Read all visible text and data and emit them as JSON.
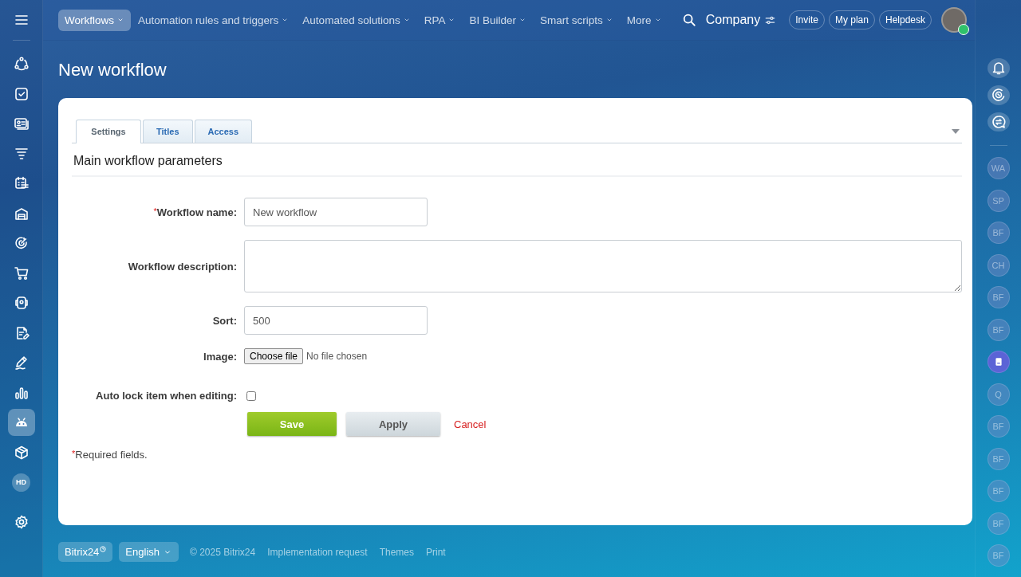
{
  "left_sidebar": {
    "items": [
      {
        "kind": "icon",
        "selected": false
      },
      {
        "kind": "icon",
        "selected": false
      },
      {
        "kind": "icon",
        "selected": false
      },
      {
        "kind": "icon",
        "selected": false
      },
      {
        "kind": "icon",
        "selected": false
      },
      {
        "kind": "icon",
        "selected": false
      },
      {
        "kind": "icon",
        "selected": false
      },
      {
        "kind": "icon",
        "selected": false
      },
      {
        "kind": "icon",
        "selected": false
      },
      {
        "kind": "icon",
        "selected": false
      },
      {
        "kind": "icon",
        "selected": false
      },
      {
        "kind": "icon",
        "selected": false
      },
      {
        "kind": "icon",
        "selected": true
      },
      {
        "kind": "icon",
        "selected": false
      },
      {
        "kind": "initials",
        "label": "HD",
        "selected": false
      }
    ]
  },
  "top_nav": {
    "items": [
      {
        "label": "Workflows",
        "selected": true
      },
      {
        "label": "Automation rules and triggers",
        "selected": false
      },
      {
        "label": "Automated solutions",
        "selected": false
      },
      {
        "label": "RPA",
        "selected": false
      },
      {
        "label": "BI Builder",
        "selected": false
      },
      {
        "label": "Smart scripts",
        "selected": false
      },
      {
        "label": "More",
        "selected": false
      }
    ],
    "company": "Company",
    "buttons": [
      "Invite",
      "My plan",
      "Helpdesk"
    ]
  },
  "page_title": "New workflow",
  "tabs": [
    {
      "label": "Settings",
      "selected": true
    },
    {
      "label": "Titles",
      "selected": false
    },
    {
      "label": "Access",
      "selected": false
    }
  ],
  "section_title": "Main workflow parameters",
  "fields": [
    {
      "kind": "text",
      "label": "Workflow name:",
      "required_mark": "*",
      "value": "New workflow"
    },
    {
      "kind": "textarea",
      "label": "Workflow description:"
    },
    {
      "kind": "text",
      "label": "Sort:",
      "value": "500"
    },
    {
      "kind": "file",
      "label": "Image:",
      "button": "Choose file",
      "status": "No file chosen"
    },
    {
      "kind": "checkbox",
      "label": "Auto lock item when editing:",
      "checked": false
    }
  ],
  "actions": [
    {
      "kind": "primary",
      "label": "Save"
    },
    {
      "kind": "secondary",
      "label": "Apply"
    },
    {
      "kind": "link",
      "label": "Cancel"
    }
  ],
  "required_note": {
    "mark": "*",
    "text": "Required fields."
  },
  "right_sidebar": {
    "items": [
      {
        "kind": "initials",
        "label": "WA"
      },
      {
        "kind": "initials",
        "label": "SP"
      },
      {
        "kind": "initials",
        "label": "BF"
      },
      {
        "kind": "initials",
        "label": "CH"
      },
      {
        "kind": "initials",
        "label": "BF"
      },
      {
        "kind": "initials",
        "label": "BF"
      },
      {
        "kind": "icon",
        "color": "#5b63d6"
      },
      {
        "kind": "initials",
        "label": "Q"
      },
      {
        "kind": "initials",
        "label": "BF"
      },
      {
        "kind": "initials",
        "label": "BF"
      },
      {
        "kind": "initials",
        "label": "BF"
      },
      {
        "kind": "initials",
        "label": "BF"
      },
      {
        "kind": "initials",
        "label": "BF"
      }
    ]
  },
  "footer": {
    "brand": "Bitrix24",
    "language": "English",
    "copyright": "© 2025 Bitrix24",
    "links": [
      "Implementation request",
      "Themes",
      "Print"
    ]
  }
}
